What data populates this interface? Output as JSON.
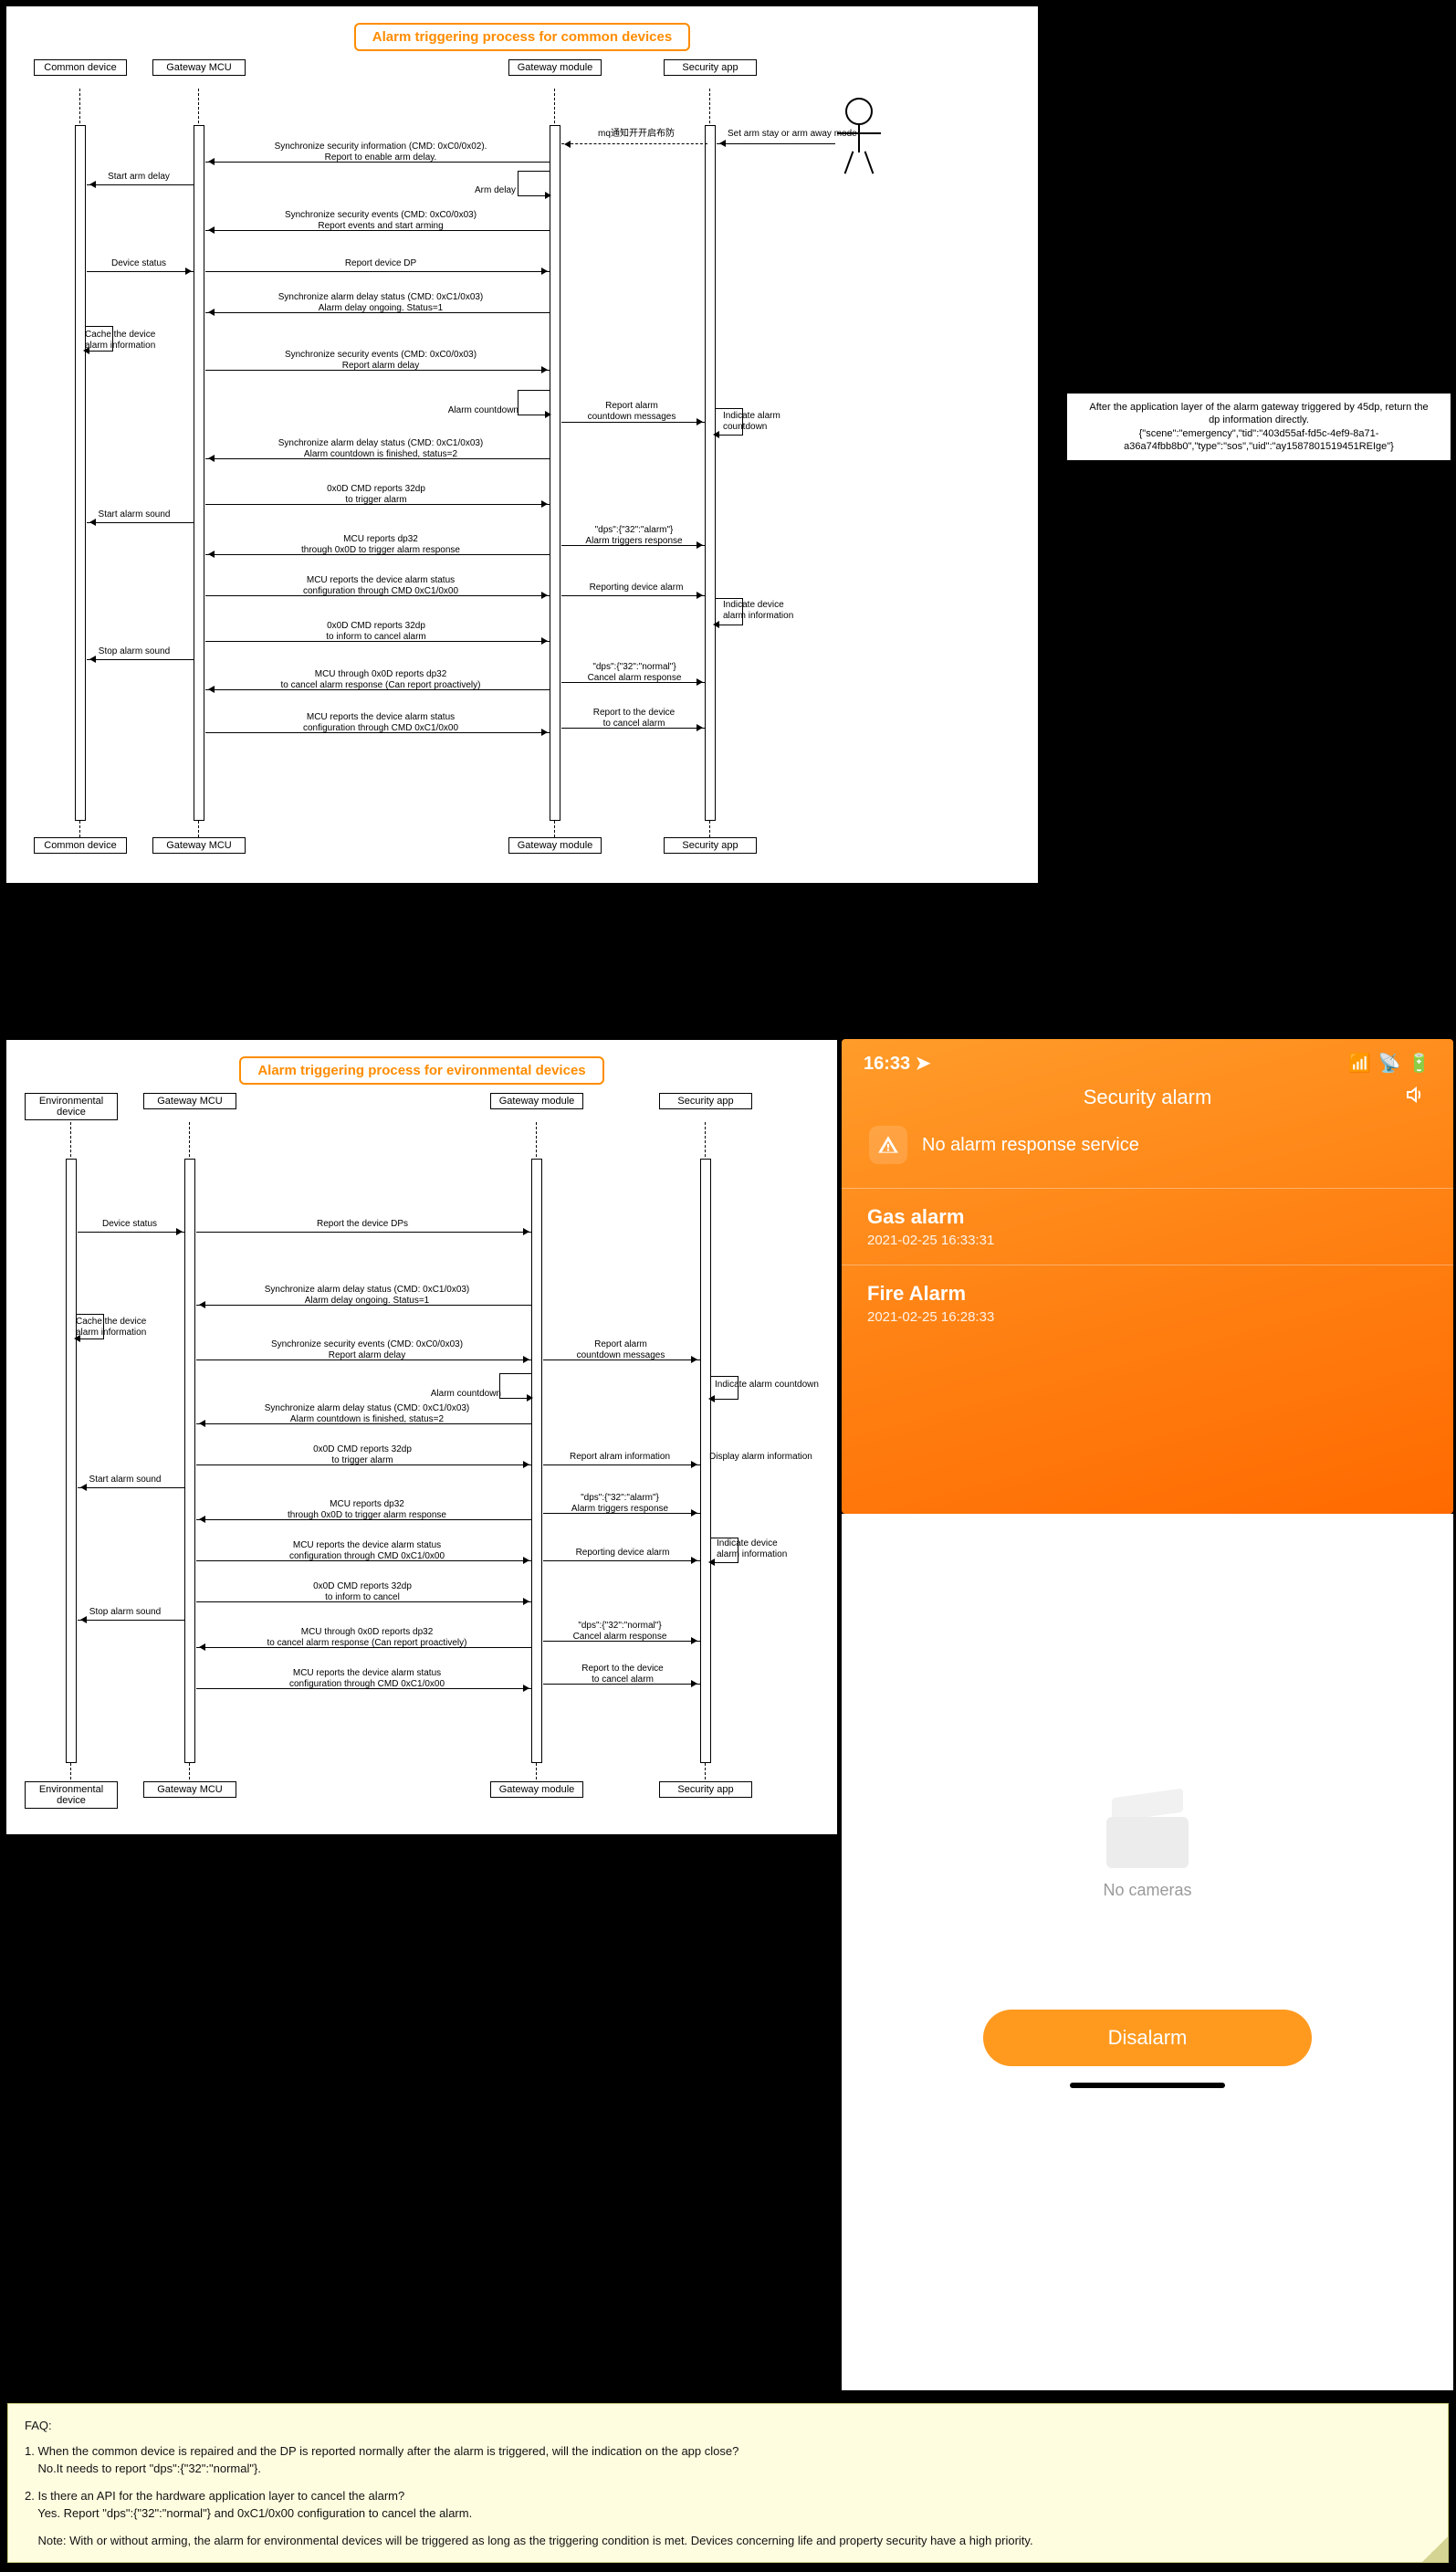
{
  "diagram1": {
    "title": "Alarm triggering process for common devices",
    "lanes": [
      "Common\ndevice",
      "Gateway\nMCU",
      "Gateway\nmodule",
      "Security\napp"
    ],
    "actor_msg": "Set arm stay or arm away mode",
    "mq_msg": "mq通知开开启布防",
    "messages": {
      "m1": "Synchronize security information (CMD: 0xC0/0x02).\nReport to enable arm delay.",
      "m2": "Start arm delay",
      "m3": "Arm delay",
      "m4": "Synchronize security events (CMD: 0xC0/0x03)\nReport events and start arming",
      "m5": "Device status",
      "m6": "Report device DP",
      "m7": "Synchronize alarm delay status (CMD: 0xC1/0x03)\nAlarm delay ongoing. Status=1",
      "m8": "Cache the device\nalarm information",
      "m9": "Synchronize security events (CMD: 0xC0/0x03)\nReport alarm delay",
      "m10": "Alarm countdown",
      "m11": "Report alarm\ncountdown messages",
      "m12": "Indicate alarm\ncountdown",
      "m13": "Synchronize alarm delay status (CMD: 0xC1/0x03)\nAlarm countdown is finished, status=2",
      "m14": "0x0D CMD reports 32dp\nto trigger alarm",
      "m15": "Start alarm sound",
      "m16": "MCU reports dp32\nthrough 0x0D to trigger alarm response",
      "m17": "\"dps\":{\"32\":\"alarm\"}\nAlarm triggers response",
      "m18": "MCU reports the device alarm status\nconfiguration through CMD 0xC1/0x00",
      "m19": "Reporting device alarm",
      "m20": "Indicate device\nalarm information",
      "m21": "0x0D CMD reports 32dp\nto inform to cancel alarm",
      "m22": "Stop alarm sound",
      "m23": "MCU through 0x0D reports dp32\nto cancel alarm response (Can report proactively)",
      "m24": "\"dps\":{\"32\":\"normal\"}\nCancel alarm response",
      "m25": "MCU reports the device alarm status\nconfiguration through CMD 0xC1/0x00",
      "m26": "Report to the device\nto cancel alarm"
    }
  },
  "side_note": "After the application layer of the alarm gateway triggered by 45dp, return the\ndp information directly.\n{\"scene\":\"emergency\",\"tid\":\"403d55af-fd5c-4ef9-8a71-\na36a74fbb8b0\",\"type\":\"sos\",\"uid\":\"ay1587801519451REIge\"}",
  "diagram2": {
    "title": "Alarm triggering process for evironmental devices",
    "lanes": [
      "Environmental\ndevice",
      "Gateway\nMCU",
      "Gateway\nmodule",
      "Security\napp"
    ],
    "messages": {
      "m5": "Device status",
      "m6": "Report the device DPs",
      "m7": "Synchronize alarm delay status (CMD: 0xC1/0x03)\nAlarm delay ongoing. Status=1",
      "m8": "Cache the device\nalarm information",
      "m9": "Synchronize security events (CMD: 0xC0/0x03)\nReport alarm delay",
      "m10": "Alarm countdown",
      "m11": "Report alarm\ncountdown messages",
      "m12": "Indicate alarm countdown",
      "m13": "Synchronize alarm delay status (CMD: 0xC1/0x03)\nAlarm countdown is finished, status=2",
      "m14": "0x0D CMD reports 32dp\nto trigger alarm",
      "m14b": "Report alram information",
      "m14c": "Display alarm information",
      "m15": "Start alarm sound",
      "m16": "MCU reports dp32\nthrough 0x0D to trigger alarm response",
      "m17": "\"dps\":{\"32\":\"alarm\"}\nAlarm triggers response",
      "m18": "MCU reports the device alarm status\nconfiguration through CMD 0xC1/0x00",
      "m19": "Reporting device alarm",
      "m20": "Indicate device\nalarm information",
      "m21": "0x0D CMD reports 32dp\nto inform to cancel",
      "m22": "Stop alarm sound",
      "m23": "MCU through 0x0D reports dp32\nto cancel alarm response (Can report proactively)",
      "m24": "\"dps\":{\"32\":\"normal\"}\nCancel alarm response",
      "m25": "MCU reports the device alarm status\nconfiguration through CMD 0xC1/0x00",
      "m26": "Report to the device\nto cancel alarm"
    }
  },
  "phone": {
    "time": "16:33",
    "signal": "▮▮▮▮",
    "title": "Security alarm",
    "notice": "No alarm response service",
    "alarms": [
      {
        "title": "Gas alarm",
        "time": "2021-02-25 16:33:31"
      },
      {
        "title": "Fire Alarm",
        "time": "2021-02-25 16:28:33"
      }
    ],
    "no_cameras": "No cameras",
    "disalarm": "Disalarm"
  },
  "faq": {
    "heading": "FAQ:",
    "q1": "1. When the common device is repaired and the DP is reported normally after the alarm is triggered, will the indication on the app close?",
    "a1": "    No.It needs to report \"dps\":{\"32\":\"normal\"}.",
    "q2": "2. Is there an API for the hardware application layer to cancel the alarm?",
    "a2": "    Yes. Report \"dps\":{\"32\":\"normal\"} and 0xC1/0x00 configuration to cancel the alarm.",
    "note": "    Note: With or without arming, the alarm for environmental devices will be triggered as long as the triggering condition is met. Devices concerning life and property security have a high priority."
  }
}
